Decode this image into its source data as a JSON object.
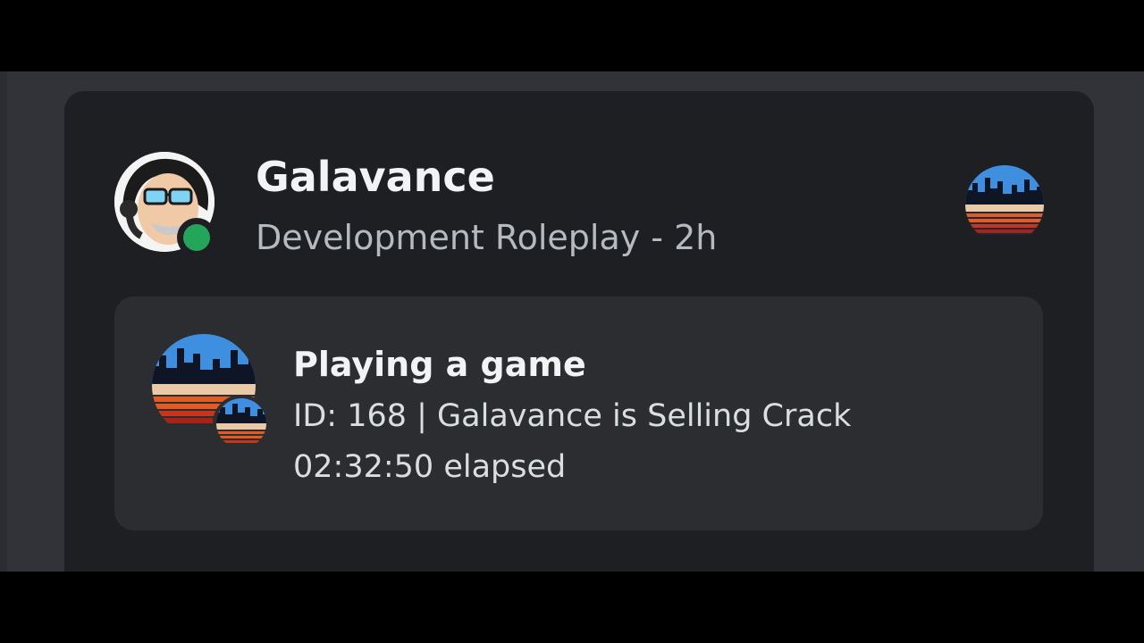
{
  "profile": {
    "username": "Galavance",
    "status_text": "Development Roleplay - 2h",
    "status_color": "#23a55a",
    "avatar_icon": "user-avatar-icon",
    "server_icon": "server-icon"
  },
  "activity": {
    "title": "Playing a game",
    "details": "ID: 168 | Galavance is Selling Crack",
    "elapsed": "02:32:50 elapsed",
    "large_image": "game-icon",
    "small_image": "game-small-icon"
  },
  "colors": {
    "card_bg": "#1e1f22",
    "activity_bg": "#2b2d31",
    "app_bg": "#313338",
    "title_text": "#f2f3f5",
    "muted_text": "#b5bac1"
  }
}
